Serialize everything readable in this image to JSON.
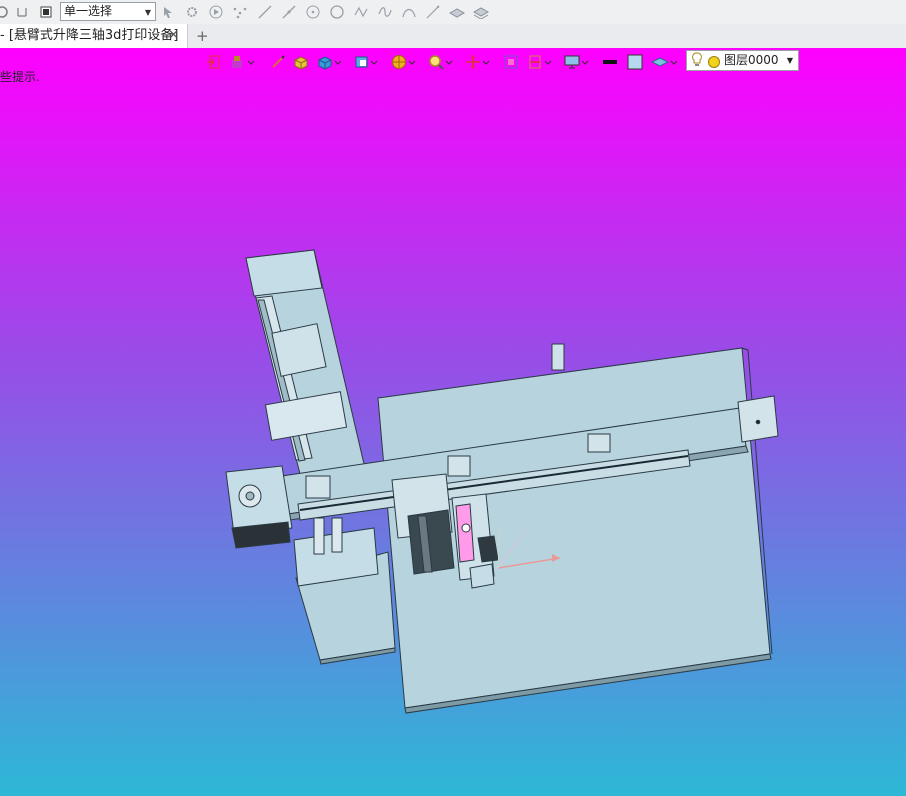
{
  "toolbar": {
    "selection_mode": "单一选择",
    "icons": [
      "rotate-icon",
      "undo-icon",
      "stop-icon",
      "pointer-icon",
      "gear-select-icon",
      "play-icon",
      "point-cloud-icon",
      "line-icon",
      "segment-icon",
      "circle-center-icon",
      "circle-icon",
      "spline-icon",
      "curve-icon",
      "arc-icon",
      "diagonal-line-icon",
      "surface-icon",
      "surface-stack-icon"
    ]
  },
  "tabs": {
    "active_label": "- [悬臂式升降三轴3d打印设备]",
    "add_symbol": "+"
  },
  "viewport": {
    "hint_text": "些提示.",
    "layer_label": "图层0000",
    "colors": {
      "gradient_top": "#ff00ff",
      "gradient_mid": "#9b4ae8",
      "gradient_bottom": "#2db8d6",
      "part_fill": "#b7d3de",
      "part_edge": "#2a3a45"
    }
  }
}
